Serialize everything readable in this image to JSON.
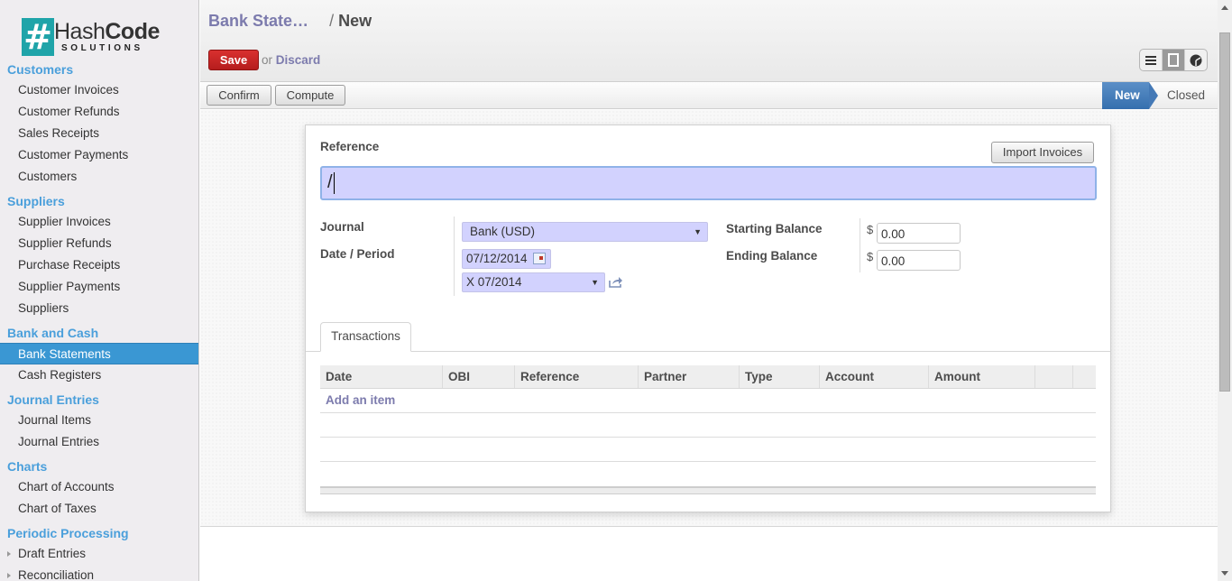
{
  "logo": {
    "mark": "#",
    "word_light": "Hash",
    "word_bold": "Code",
    "sub": "SOLUTIONS"
  },
  "sidebar": {
    "sections": [
      {
        "title": "Customers",
        "items": [
          "Customer Invoices",
          "Customer Refunds",
          "Sales Receipts",
          "Customer Payments",
          "Customers"
        ]
      },
      {
        "title": "Suppliers",
        "items": [
          "Supplier Invoices",
          "Supplier Refunds",
          "Purchase Receipts",
          "Supplier Payments",
          "Suppliers"
        ]
      },
      {
        "title": "Bank and Cash",
        "items": [
          "Bank Statements",
          "Cash Registers"
        ],
        "active": "Bank Statements"
      },
      {
        "title": "Journal Entries",
        "items": [
          "Journal Items",
          "Journal Entries"
        ]
      },
      {
        "title": "Charts",
        "items": [
          "Chart of Accounts",
          "Chart of Taxes"
        ]
      },
      {
        "title": "Periodic Processing",
        "items": [
          "Draft Entries",
          "Reconciliation"
        ],
        "expandable": true
      }
    ]
  },
  "header": {
    "breadcrumb_parent": "Bank State…",
    "breadcrumb_sep": "/",
    "breadcrumb_current": "New",
    "save_label": "Save",
    "or_label": "or",
    "discard_label": "Discard",
    "views": [
      "list-view-icon",
      "form-view-icon",
      "graph-view-icon"
    ],
    "active_view": "form-view-icon"
  },
  "statusbar": {
    "confirm_label": "Confirm",
    "compute_label": "Compute",
    "stages": [
      "New",
      "Closed"
    ],
    "current_stage": "New"
  },
  "form": {
    "reference_label": "Reference",
    "reference_value": "/",
    "import_label": "Import Invoices",
    "journal_label": "Journal",
    "journal_value": "Bank (USD)",
    "date_period_label": "Date / Period",
    "date_value": "07/12/2014",
    "period_value": "X 07/2014",
    "starting_balance_label": "Starting Balance",
    "ending_balance_label": "Ending Balance",
    "currency_symbol": "$",
    "starting_balance": "0.00",
    "ending_balance": "0.00"
  },
  "tabs": {
    "transactions": "Transactions"
  },
  "grid": {
    "columns": [
      "Date",
      "OBI",
      "Reference",
      "Partner",
      "Type",
      "Account",
      "Amount",
      "",
      ""
    ],
    "add_item": "Add an item"
  },
  "colors": {
    "accent": "#7c7bad",
    "save": "#c42727",
    "active_menu": "#3a97d3",
    "section": "#4a9fdb",
    "required_field": "#d2d2fe"
  }
}
